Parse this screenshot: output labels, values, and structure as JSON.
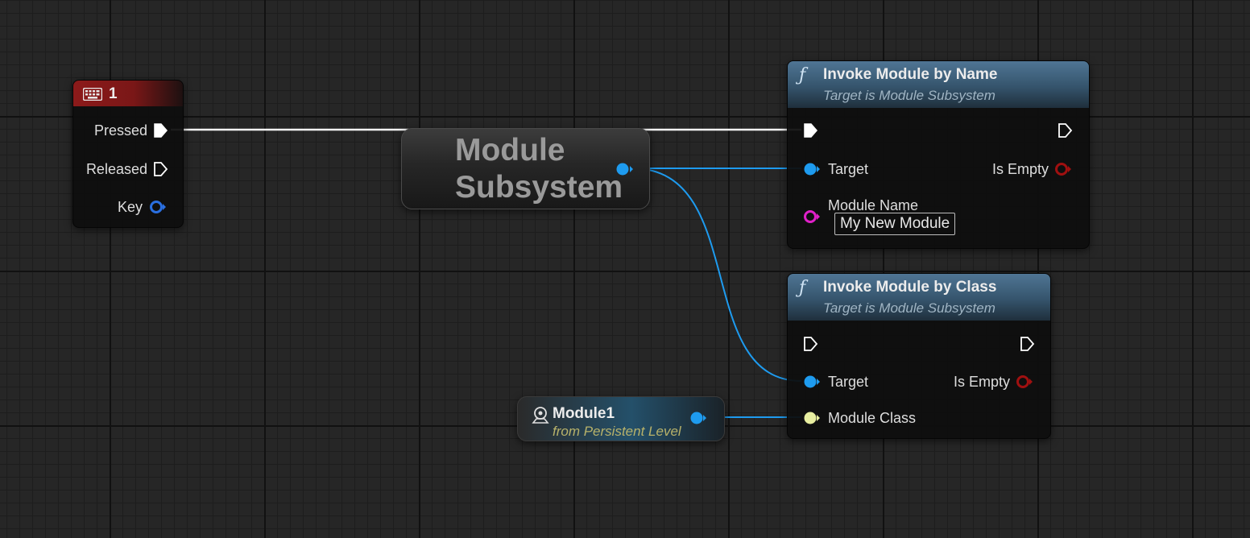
{
  "graph": {
    "key_event": {
      "title": "1",
      "pins": {
        "pressed": "Pressed",
        "released": "Released",
        "key": "Key"
      },
      "header_color": "#8c1a1a"
    },
    "module_subsystem": {
      "title_line1": "Module",
      "title_line2": "Subsystem",
      "output_pin_color": "#1e9bef"
    },
    "invoke_by_name": {
      "title": "Invoke Module by Name",
      "subtitle": "Target is Module Subsystem",
      "pins": {
        "target": "Target",
        "is_empty": "Is Empty",
        "module_name": "Module Name"
      },
      "module_name_value": "My New Module",
      "icon": "function-icon"
    },
    "invoke_by_class": {
      "title": "Invoke Module by Class",
      "subtitle": "Target is Module Subsystem",
      "pins": {
        "target": "Target",
        "is_empty": "Is Empty",
        "module_class": "Module Class"
      },
      "icon": "function-icon"
    },
    "module1_ref": {
      "title": "Module1",
      "subtitle": "from Persistent Level",
      "icon": "actor-icon"
    },
    "colors": {
      "exec": "#ffffff",
      "object_pin": "#1e9bef",
      "key_pin": "#2a6fe0",
      "bool_pin": "#a01010",
      "string_pin": "#e020c8",
      "class_pin": "#e8eea0"
    }
  }
}
